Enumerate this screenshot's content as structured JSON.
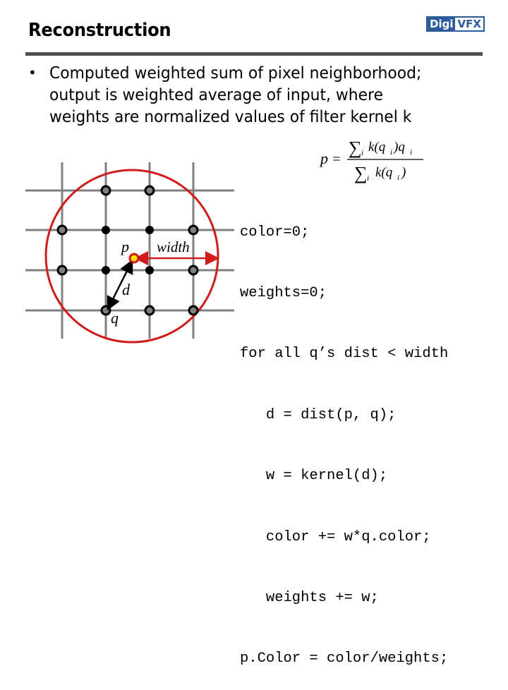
{
  "slide": {
    "title": "Reconstruction",
    "logo": {
      "part1": "Digi",
      "part2": "VFX",
      "color": "#2d5c9e"
    },
    "bullet": {
      "marker": "•",
      "text": "Computed weighted sum of pixel neighborhood;\noutput is weighted average of input, where\nweights are normalized values of filter kernel k"
    },
    "formula": {
      "lhs": "p",
      "equals": "=",
      "numerator": {
        "sum": "∑",
        "index": "i",
        "expr": "k(q",
        "sub": "i",
        "close": ")q",
        "sub2": "i"
      },
      "denominator": {
        "sum": "∑",
        "index": "i",
        "expr": "k(q",
        "sub": "i",
        "close": ")"
      }
    },
    "diagram": {
      "labels": {
        "p": "p",
        "q": "q",
        "d": "d",
        "width": "width"
      },
      "colors": {
        "grid": "#808080",
        "circle": "#d11a1a",
        "center_fill": "#ffe000",
        "inner_dot": "#000000",
        "outer_dot": "#808080"
      },
      "grid_cols": 4,
      "grid_rows": 4,
      "samples": [
        {
          "col": 1,
          "row": 0,
          "kind": "outer"
        },
        {
          "col": 2,
          "row": 0,
          "kind": "outer"
        },
        {
          "col": 0,
          "row": 1,
          "kind": "outer"
        },
        {
          "col": 1,
          "row": 1,
          "kind": "inner"
        },
        {
          "col": 2,
          "row": 1,
          "kind": "inner"
        },
        {
          "col": 3,
          "row": 1,
          "kind": "outer"
        },
        {
          "col": 0,
          "row": 2,
          "kind": "outer"
        },
        {
          "col": 1,
          "row": 2,
          "kind": "inner"
        },
        {
          "col": 2,
          "row": 2,
          "kind": "inner"
        },
        {
          "col": 3,
          "row": 2,
          "kind": "outer"
        },
        {
          "col": 1,
          "row": 3,
          "kind": "outer"
        },
        {
          "col": 2,
          "row": 3,
          "kind": "outer"
        },
        {
          "col": 3,
          "row": 3,
          "kind": "outer"
        }
      ]
    },
    "code": [
      "color=0;",
      "weights=0;",
      "for all q’s dist < width",
      "   d = dist(p, q);",
      "   w = kernel(d);",
      "   color += w*q.color;",
      "   weights += w;",
      "p.Color = color/weights;"
    ]
  }
}
